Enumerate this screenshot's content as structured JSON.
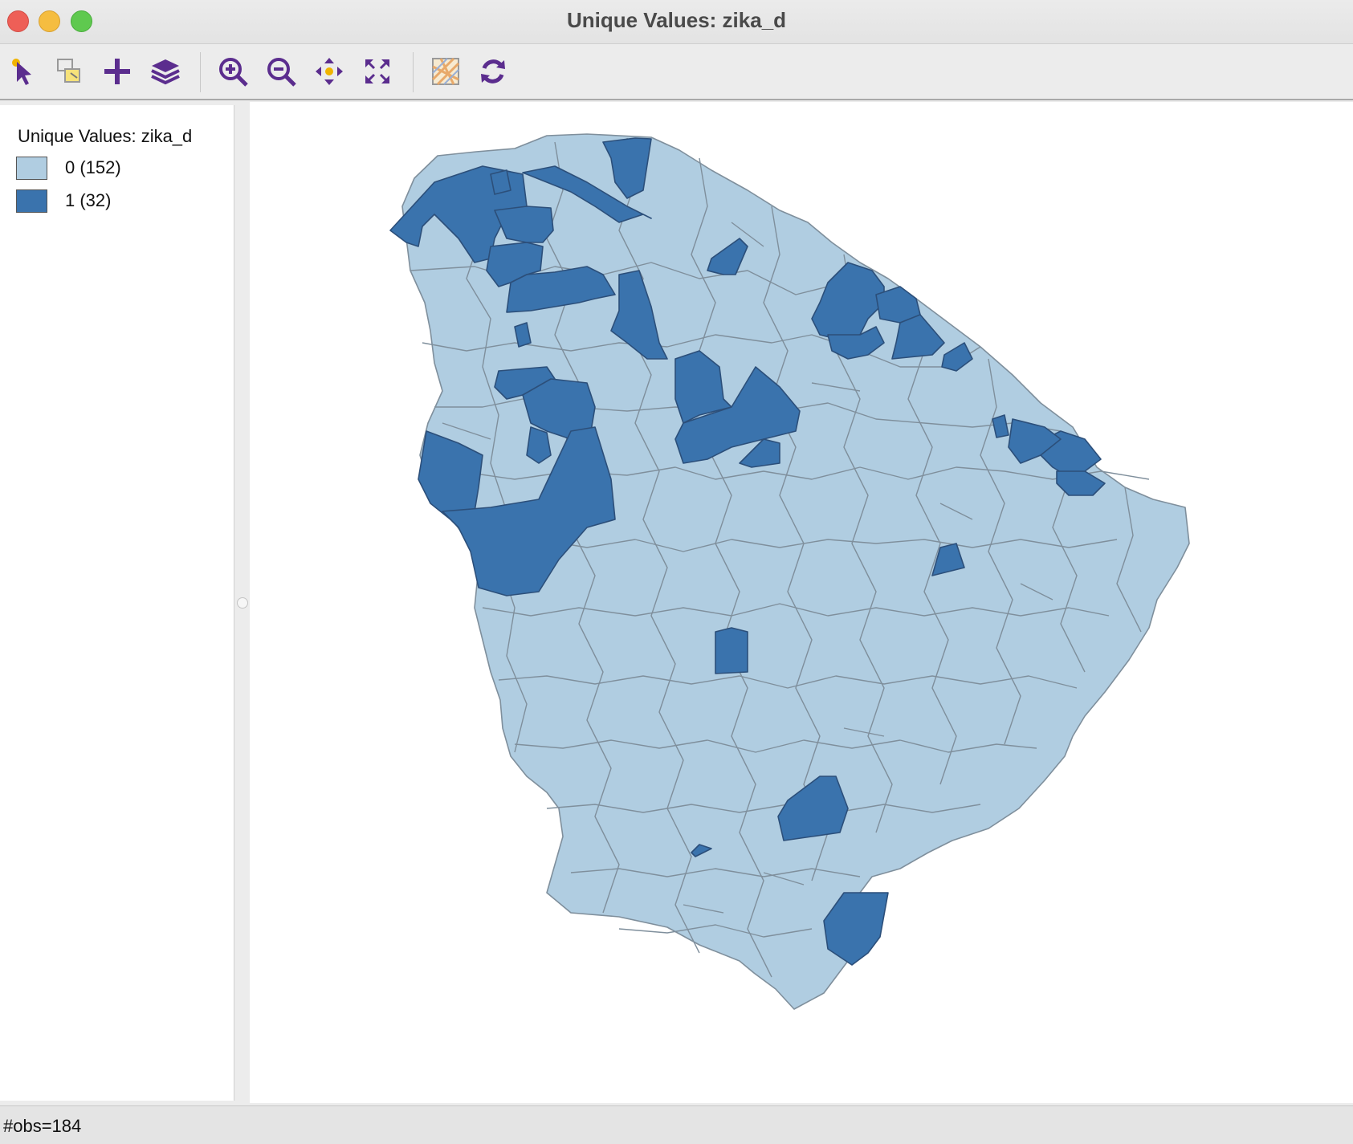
{
  "window": {
    "title": "Unique Values: zika_d"
  },
  "toolbar": {
    "buttons": [
      {
        "name": "select-tool",
        "icon": "select-arrow-icon"
      },
      {
        "name": "selection-shape",
        "icon": "selection-shape-icon"
      },
      {
        "name": "add",
        "icon": "plus-icon"
      },
      {
        "name": "layers",
        "icon": "layers-icon"
      },
      {
        "name": "zoom-in",
        "icon": "zoom-in-icon"
      },
      {
        "name": "zoom-out",
        "icon": "zoom-out-icon"
      },
      {
        "name": "pan",
        "icon": "pan-icon"
      },
      {
        "name": "full-extent",
        "icon": "full-extent-icon"
      },
      {
        "name": "basemap",
        "icon": "basemap-icon"
      },
      {
        "name": "refresh",
        "icon": "refresh-icon"
      }
    ],
    "icon_color": "#5b2d8e"
  },
  "legend": {
    "title": "Unique Values: zika_d",
    "items": [
      {
        "label": "0 (152)",
        "color": "#b0cde1"
      },
      {
        "label": "1 (32)",
        "color": "#3a73ad"
      }
    ]
  },
  "map": {
    "fill_light": "#b0cde1",
    "fill_dark": "#3a73ad",
    "stroke": "#7f8f9c"
  },
  "status": {
    "text": "#obs=184"
  }
}
